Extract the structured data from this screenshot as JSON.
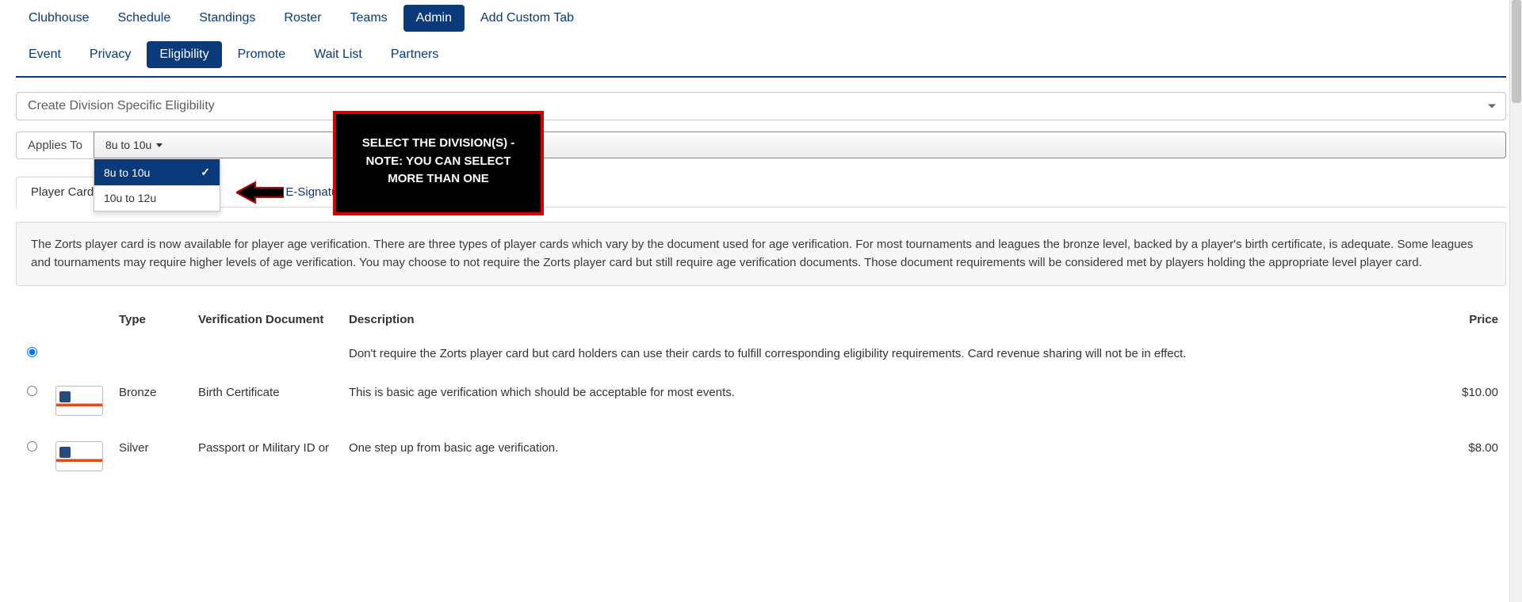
{
  "topnav": {
    "items": [
      {
        "label": "Clubhouse"
      },
      {
        "label": "Schedule"
      },
      {
        "label": "Standings"
      },
      {
        "label": "Roster"
      },
      {
        "label": "Teams"
      },
      {
        "label": "Admin"
      },
      {
        "label": "Add Custom Tab"
      }
    ],
    "active_index": 5
  },
  "subnav": {
    "items": [
      {
        "label": "Event"
      },
      {
        "label": "Privacy"
      },
      {
        "label": "Eligibility"
      },
      {
        "label": "Promote"
      },
      {
        "label": "Wait List"
      },
      {
        "label": "Partners"
      }
    ],
    "active_index": 2
  },
  "division_select": {
    "placeholder": "Create Division Specific Eligibility"
  },
  "applies_to": {
    "label": "Applies To",
    "button_text": "8u to 10u",
    "options": [
      {
        "label": "8u to 10u",
        "selected": true
      },
      {
        "label": "10u to 12u",
        "selected": false
      }
    ]
  },
  "inner_tabs": {
    "items": [
      {
        "label": "Player Card"
      },
      {
        "label": "E-Signatures"
      }
    ],
    "active_index": 0
  },
  "description": "The Zorts player card is now available for player age verification. There are three types of player cards which vary by the document used for age verification. For most tournaments and leagues the bronze level, backed by a player's birth certificate, is adequate. Some leagues and tournaments may require higher levels of age verification. You may choose to not require the Zorts player card but still require age verification documents. Those document requirements will be considered met by players holding the appropriate level player card.",
  "table": {
    "headers": {
      "type": "Type",
      "doc": "Verification Document",
      "desc": "Description",
      "price": "Price"
    },
    "rows": [
      {
        "selected": true,
        "has_thumb": false,
        "type": "",
        "doc": "",
        "desc": "Don't require the Zorts player card but card holders can use their cards to fulfill corresponding eligibility requirements. Card revenue sharing will not be in effect.",
        "price": ""
      },
      {
        "selected": false,
        "has_thumb": true,
        "type": "Bronze",
        "doc": "Birth Certificate",
        "desc": "This is basic age verification which should be acceptable for most events.",
        "price": "$10.00"
      },
      {
        "selected": false,
        "has_thumb": true,
        "type": "Silver",
        "doc": "Passport or Military ID or",
        "desc": "One step up from basic age verification.",
        "price": "$8.00"
      }
    ]
  },
  "callout": {
    "line1": "SELECT THE DIVISION(S) -",
    "line2": "NOTE: YOU CAN SELECT",
    "line3": "MORE THAN ONE"
  }
}
